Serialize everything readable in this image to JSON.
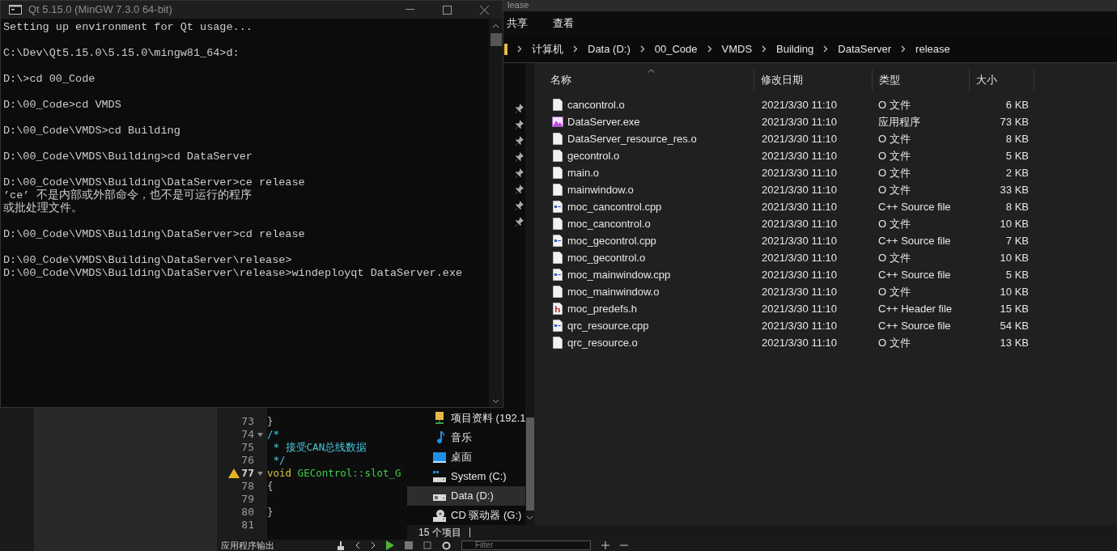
{
  "console": {
    "title": "Qt 5.15.0 (MinGW 7.3.0 64-bit)",
    "blocks": [
      [
        "Setting up environment for Qt usage..."
      ],
      [
        "C:\\Dev\\Qt5.15.0\\5.15.0\\mingw81_64>d:"
      ],
      [
        "D:\\>cd 00_Code"
      ],
      [
        "D:\\00_Code>cd VMDS"
      ],
      [
        "D:\\00_Code\\VMDS>cd Building"
      ],
      [
        "D:\\00_Code\\VMDS\\Building>cd DataServer"
      ],
      [
        "D:\\00_Code\\VMDS\\Building\\DataServer>ce release",
        "’ce’ 不是内部或外部命令，也不是可运行的程序",
        "或批处理文件。"
      ],
      [
        "D:\\00_Code\\VMDS\\Building\\DataServer>cd release"
      ],
      [
        "D:\\00_Code\\VMDS\\Building\\DataServer\\release>",
        "D:\\00_Code\\VMDS\\Building\\DataServer\\release>windeployqt DataServer.exe"
      ]
    ]
  },
  "explorer": {
    "title": "lease",
    "ribbon_tabs": [
      "共享",
      "查看"
    ],
    "breadcrumb": [
      "计算机",
      "Data (D:)",
      "00_Code",
      "VMDS",
      "Building",
      "DataServer",
      "release"
    ],
    "columns": [
      "名称",
      "修改日期",
      "类型",
      "大小"
    ],
    "files": [
      {
        "name": "cancontrol.o",
        "modified": "2021/3/30 11:10",
        "type": "O 文件",
        "size": "6 KB",
        "kind": "object"
      },
      {
        "name": "DataServer.exe",
        "modified": "2021/3/30 11:10",
        "type": "应用程序",
        "size": "73 KB",
        "kind": "exe"
      },
      {
        "name": "DataServer_resource_res.o",
        "modified": "2021/3/30 11:10",
        "type": "O 文件",
        "size": "8 KB",
        "kind": "object"
      },
      {
        "name": "gecontrol.o",
        "modified": "2021/3/30 11:10",
        "type": "O 文件",
        "size": "5 KB",
        "kind": "object"
      },
      {
        "name": "main.o",
        "modified": "2021/3/30 11:10",
        "type": "O 文件",
        "size": "2 KB",
        "kind": "object"
      },
      {
        "name": "mainwindow.o",
        "modified": "2021/3/30 11:10",
        "type": "O 文件",
        "size": "33 KB",
        "kind": "object"
      },
      {
        "name": "moc_cancontrol.cpp",
        "modified": "2021/3/30 11:10",
        "type": "C++ Source file",
        "size": "8 KB",
        "kind": "cpp"
      },
      {
        "name": "moc_cancontrol.o",
        "modified": "2021/3/30 11:10",
        "type": "O 文件",
        "size": "10 KB",
        "kind": "object"
      },
      {
        "name": "moc_gecontrol.cpp",
        "modified": "2021/3/30 11:10",
        "type": "C++ Source file",
        "size": "7 KB",
        "kind": "cpp"
      },
      {
        "name": "moc_gecontrol.o",
        "modified": "2021/3/30 11:10",
        "type": "O 文件",
        "size": "10 KB",
        "kind": "object"
      },
      {
        "name": "moc_mainwindow.cpp",
        "modified": "2021/3/30 11:10",
        "type": "C++ Source file",
        "size": "5 KB",
        "kind": "cpp"
      },
      {
        "name": "moc_mainwindow.o",
        "modified": "2021/3/30 11:10",
        "type": "O 文件",
        "size": "10 KB",
        "kind": "object"
      },
      {
        "name": "moc_predefs.h",
        "modified": "2021/3/30 11:10",
        "type": "C++ Header file",
        "size": "15 KB",
        "kind": "header"
      },
      {
        "name": "qrc_resource.cpp",
        "modified": "2021/3/30 11:10",
        "type": "C++ Source file",
        "size": "54 KB",
        "kind": "cpp"
      },
      {
        "name": "qrc_resource.o",
        "modified": "2021/3/30 11:10",
        "type": "O 文件",
        "size": "13 KB",
        "kind": "object"
      }
    ],
    "quick_access_pins": [
      {
        "pinned": true
      },
      {
        "pinned": true
      },
      {
        "pinned": true
      },
      {
        "pinned": true
      },
      {
        "pinned": true
      },
      {
        "pinned": true
      },
      {
        "pinned": true
      },
      {
        "pinned": true
      }
    ],
    "nav_items": [
      {
        "label": "项目资料 (192.1",
        "kind": "network",
        "selected": false
      },
      {
        "label": "音乐",
        "kind": "music",
        "selected": false
      },
      {
        "label": "桌面",
        "kind": "desktop",
        "selected": false
      },
      {
        "label": "System (C:)",
        "kind": "system-drive",
        "selected": false
      },
      {
        "label": "Data (D:)",
        "kind": "drive",
        "selected": true
      },
      {
        "label": "CD 驱动器 (G:)",
        "kind": "cd",
        "selected": false
      }
    ],
    "status": "15 个项目"
  },
  "editor": {
    "lines": [
      {
        "number": "73",
        "warning": false,
        "foldable": false,
        "segments": [
          {
            "text": "}",
            "kind": "plain"
          }
        ]
      },
      {
        "number": "74",
        "warning": false,
        "foldable": true,
        "segments": [
          {
            "text": "/*",
            "kind": "comment"
          }
        ]
      },
      {
        "number": "75",
        "warning": false,
        "foldable": false,
        "segments": [
          {
            "text": " * 接受CAN总线数据",
            "kind": "comment"
          }
        ]
      },
      {
        "number": "76",
        "warning": false,
        "foldable": false,
        "segments": [
          {
            "text": " */",
            "kind": "comment"
          }
        ]
      },
      {
        "number": "77",
        "warning": true,
        "foldable": true,
        "segments": [
          {
            "text": "void",
            "kind": "keyword"
          },
          {
            "text": "GEControl::slot_G",
            "kind": "function"
          }
        ]
      },
      {
        "number": "78",
        "warning": false,
        "foldable": false,
        "segments": [
          {
            "text": "{",
            "kind": "plain"
          }
        ]
      },
      {
        "number": "79",
        "warning": false,
        "foldable": false
      },
      {
        "number": "80",
        "warning": false,
        "foldable": false,
        "segments": [
          {
            "text": "}",
            "kind": "plain"
          }
        ]
      },
      {
        "number": "81",
        "warning": false,
        "foldable": false
      }
    ]
  },
  "output_pane": {
    "title": "应用程序输出",
    "filter_placeholder": "Filter"
  }
}
